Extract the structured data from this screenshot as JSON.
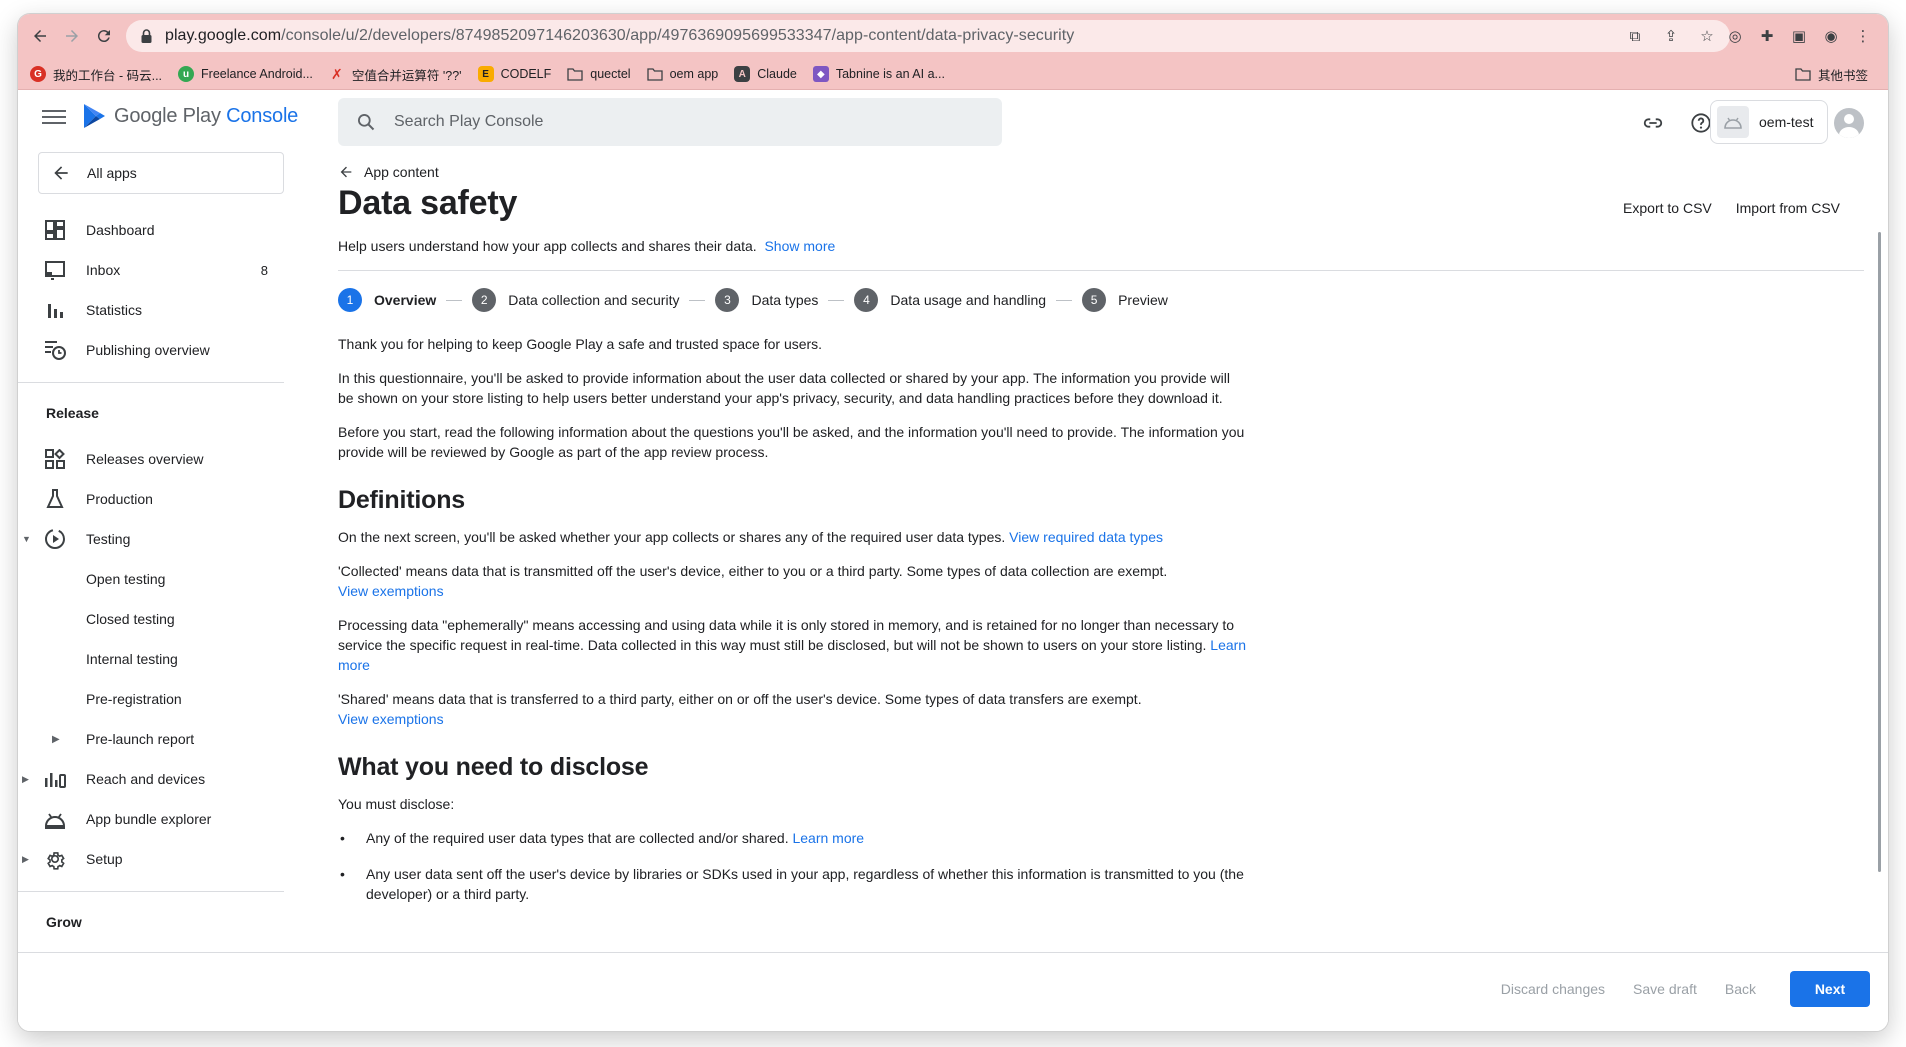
{
  "browser": {
    "url_host": "play.google.com",
    "url_path": "/console/u/2/developers/8749852097146203630/app/4976369095699533347/app-content/data-privacy-security",
    "bookmarks": [
      {
        "label": "我的工作台 - 码云...",
        "color": "#d93025"
      },
      {
        "label": "Freelance Android...",
        "color": "#34a853"
      },
      {
        "label": "空值合并运算符 '??'",
        "color": "#d93025"
      },
      {
        "label": "CODELF",
        "color": "#f9ab00"
      },
      {
        "label": "quectel",
        "color": "folder"
      },
      {
        "label": "oem app",
        "color": "folder"
      },
      {
        "label": "Claude",
        "color": "#3c4043"
      },
      {
        "label": "Tabnine is an AI a...",
        "color": "#7e57c2"
      }
    ],
    "other_bookmarks": "其他书签"
  },
  "header": {
    "brand_main": "Google Play",
    "brand_accent": "Console",
    "search_placeholder": "Search Play Console",
    "account_name": "oem-test"
  },
  "sidebar": {
    "all_apps": "All apps",
    "items_top": [
      {
        "label": "Dashboard",
        "icon": "dashboard-icon"
      },
      {
        "label": "Inbox",
        "icon": "inbox-icon",
        "count": "8"
      },
      {
        "label": "Statistics",
        "icon": "statistics-icon"
      },
      {
        "label": "Publishing overview",
        "icon": "publishing-overview-icon"
      }
    ],
    "release_heading": "Release",
    "release_items": [
      {
        "label": "Releases overview",
        "icon": "releases-overview-icon"
      },
      {
        "label": "Production",
        "icon": "production-icon"
      },
      {
        "label": "Testing",
        "icon": "testing-icon"
      },
      {
        "label": "Open testing"
      },
      {
        "label": "Closed testing"
      },
      {
        "label": "Internal testing"
      },
      {
        "label": "Pre-registration"
      },
      {
        "label": "Pre-launch report"
      },
      {
        "label": "Reach and devices",
        "icon": "reach-and-devices-icon"
      },
      {
        "label": "App bundle explorer",
        "icon": "app-bundle-explorer-icon"
      },
      {
        "label": "Setup",
        "icon": "setup-icon"
      }
    ],
    "grow_heading": "Grow"
  },
  "main": {
    "back_label": "App content",
    "title": "Data safety",
    "export_label": "Export to CSV",
    "import_label": "Import from CSV",
    "subtitle": "Help users understand how your app collects and shares their data.",
    "show_more": "Show more",
    "steps": [
      {
        "num": "1",
        "label": "Overview"
      },
      {
        "num": "2",
        "label": "Data collection and security"
      },
      {
        "num": "3",
        "label": "Data types"
      },
      {
        "num": "4",
        "label": "Data usage and handling"
      },
      {
        "num": "5",
        "label": "Preview"
      }
    ],
    "intro_1": "Thank you for helping to keep Google Play a safe and trusted space for users.",
    "intro_2": "In this questionnaire, you'll be asked to provide information about the user data collected or shared by your app. The information you provide will be shown on your store listing to help users better understand your app's privacy, security, and data handling practices before they download it.",
    "intro_3": "Before you start, read the following information about the questions you'll be asked, and the information you'll need to provide. The information you provide will be reviewed by Google as part of the app review process.",
    "definitions_heading": "Definitions",
    "def_1": "On the next screen, you'll be asked whether your app collects or shares any of the required user data types.",
    "def_1_link": "View required data types",
    "def_2": "'Collected' means data that is transmitted off the user's device, either to you or a third party. Some types of data collection are exempt.",
    "def_2_link": "View exemptions",
    "def_3": "Processing data \"ephemerally\" means accessing and using data while it is only stored in memory, and is retained for no longer than necessary to service the specific request in real-time. Data collected in this way must still be disclosed, but will not be shown to users on your store listing.",
    "def_3_link": "Learn more",
    "def_4": "'Shared' means data that is transferred to a third party, either on or off the user's device. Some types of data transfers are exempt.",
    "def_4_link": "View exemptions",
    "disclose_heading": "What you need to disclose",
    "disclose_intro": "You must disclose:",
    "bullet_1": "Any of the required user data types that are collected and/or shared.",
    "bullet_1_link": "Learn more",
    "bullet_2": "Any user data sent off the user's device by libraries or SDKs used in your app, regardless of whether this information is transmitted to you (the developer) or a third party."
  },
  "footer": {
    "discard": "Discard changes",
    "save_draft": "Save draft",
    "back": "Back",
    "next": "Next"
  },
  "colors": {
    "accent": "#1a73e8",
    "chrome_bg": "#f4c4c4"
  }
}
